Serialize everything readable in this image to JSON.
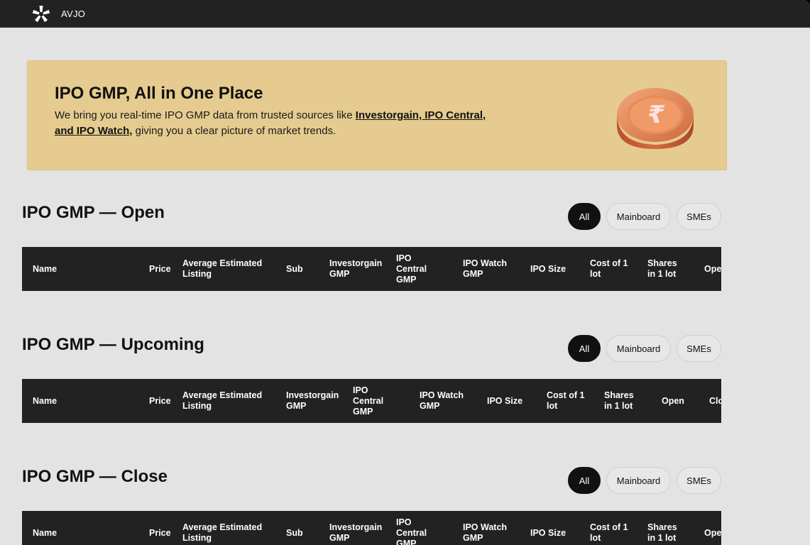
{
  "app": {
    "brand": "AVJO",
    "logo_icon": "avjo-asterisk-logo-icon"
  },
  "hero": {
    "title": "IPO GMP, All in One Place",
    "text_before": "We bring you real-time IPO GMP data from trusted sources like ",
    "link_text": "Investorgain, IPO Central, and IPO Watch,",
    "text_after": " giving you a clear picture of market trends.",
    "image_icon": "rupee-coin-icon",
    "background": "#e5cb8f"
  },
  "filters": {
    "all": "All",
    "mainboard": "Mainboard",
    "smes": "SMEs",
    "active": "All"
  },
  "sections": {
    "open": {
      "title": "IPO GMP — Open",
      "columns": [
        "Name",
        "Price",
        "Average Estimated Listing",
        "Sub",
        "Investorgain GMP",
        "IPO Central GMP",
        "IPO Watch GMP",
        "IPO Size",
        "Cost of 1 lot",
        "Shares in 1 lot",
        "Open"
      ]
    },
    "upcoming": {
      "title": "IPO GMP — Upcoming",
      "columns": [
        "Name",
        "Price",
        "Average Estimated Listing",
        "Investorgain GMP",
        "IPO Central GMP",
        "IPO Watch GMP",
        "IPO Size",
        "Cost of 1 lot",
        "Shares in 1 lot",
        "Open",
        "Close"
      ]
    },
    "close": {
      "title": "IPO GMP — Close",
      "columns": [
        "Name",
        "Price",
        "Average Estimated Listing",
        "Sub",
        "Investorgain GMP",
        "IPO Central GMP",
        "IPO Watch GMP",
        "IPO Size",
        "Cost of 1 lot",
        "Shares in 1 lot",
        "Open"
      ]
    }
  },
  "colors": {
    "topbar": "#222222",
    "page": "#e3e3e3",
    "table_header": "#222222",
    "active_pill": "#111111"
  }
}
